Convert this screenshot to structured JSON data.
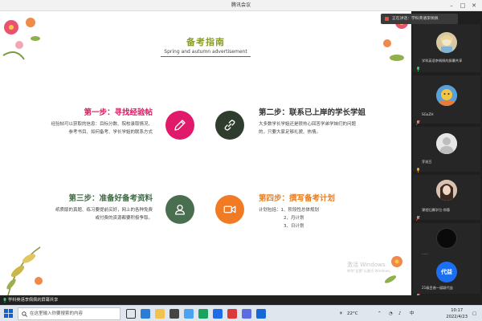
{
  "window": {
    "title": "腾讯会议"
  },
  "notice": {
    "text": "正在讲话：学科英语李佩佩"
  },
  "slide": {
    "title": "备考指南",
    "subtitle": "Spring and autumn advertisement",
    "steps": [
      {
        "heading": "第一步：寻找经验帖",
        "color": "#d81b60",
        "lines": [
          "经验帖可以获取的信息：目标分数、院校录取情况、",
          "参考书目、如何备考、学长学姐的联系方式"
        ],
        "icon": "pencil-icon",
        "circle": "#e0196a"
      },
      {
        "heading": "第二步：联系已上岸的学长学姐",
        "color": "#333333",
        "lines": [
          "大多数学长学姐还是很热心回答学弟学妹们的问题",
          "的，只要大家足够礼貌、热情。"
        ],
        "icon": "link-icon",
        "circle": "#2f3d2e"
      },
      {
        "heading": "第三步：准备好备考资料",
        "color": "#3d6b43",
        "lines": [
          "纸质版的真题、练习要提前买好，网上的各种免费",
          "或付费的资源都要积极争取。"
        ],
        "icon": "user-icon",
        "circle": "#4a6e50"
      },
      {
        "heading": "第四步：撰写备考计划",
        "color": "#e67e22",
        "lines": [
          "计划包括：1、阶段性总体规划",
          "2、月计划",
          "3、日计划"
        ],
        "icon": "video-icon",
        "circle": "#f07b24"
      }
    ],
    "watermark": {
      "line1": "激活 Windows",
      "line2": "转到\"设置\"以激活 Windows。"
    }
  },
  "participants": [
    {
      "name": "学科英语李佩佩的屏幕共享",
      "avatar_color": "#d9c9a3",
      "avatar_kind": "anime"
    },
    {
      "name": "SGaZH",
      "avatar_color": "#5aa0d8",
      "avatar_kind": "cartoon"
    },
    {
      "name": "芽斑豆",
      "avatar_color": "#e0e0e0",
      "avatar_kind": "default"
    },
    {
      "name": "课程归属学位-郑蓉",
      "avatar_color": "#caa48a",
      "avatar_kind": "photo"
    },
    {
      "name": "......",
      "avatar_color": "#0a0a0a",
      "avatar_kind": "dark"
    },
    {
      "name": "21级目香一展颖代益",
      "avatar_color": "#1c6ff0",
      "avatar_kind": "text",
      "avatar_text": "代益"
    }
  ],
  "share_bar": {
    "text": "学科英语李佩佩的屏幕共享"
  },
  "taskbar": {
    "search_placeholder": "在这里输入你要搜索的内容",
    "temperature": "22°C",
    "ime": "中",
    "time": "10:17",
    "date": "2022/4/23"
  }
}
